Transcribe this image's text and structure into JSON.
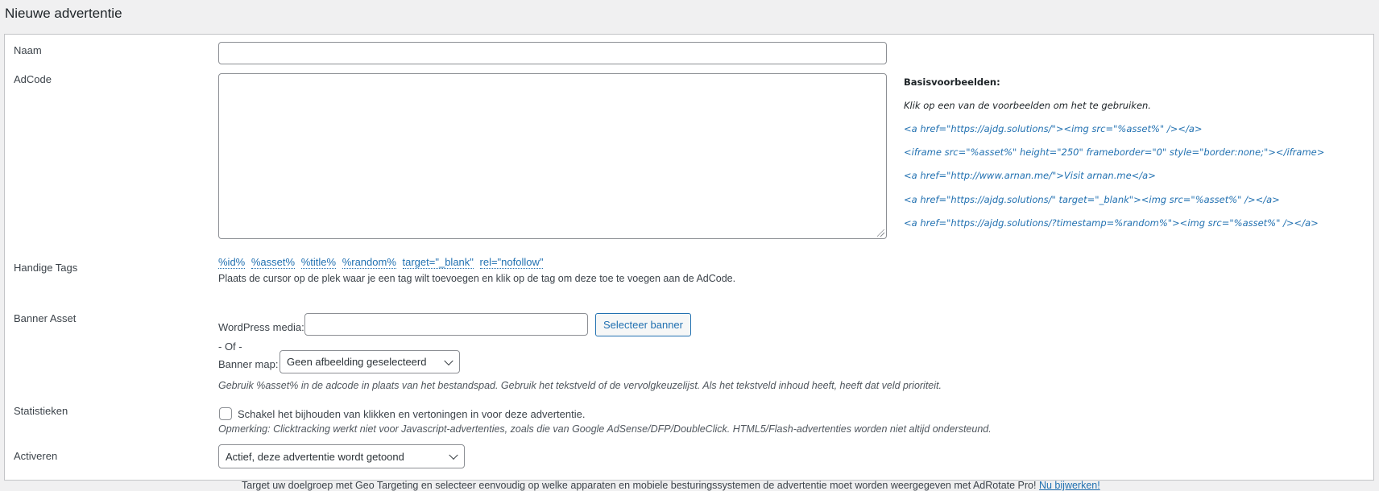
{
  "page": {
    "title": "Nieuwe advertentie"
  },
  "fields": {
    "name": {
      "label": "Naam",
      "value": "",
      "placeholder": ""
    },
    "adcode": {
      "label": "AdCode",
      "value": ""
    },
    "tags": {
      "label": "Handige Tags",
      "items": [
        "%id%",
        "%asset%",
        "%title%",
        "%random%",
        "target=\"_blank\"",
        "rel=\"nofollow\""
      ],
      "hint": "Plaats de cursor op de plek waar je een tag wilt toevoegen en klik op de tag om deze toe te voegen aan de AdCode."
    },
    "banner": {
      "label": "Banner Asset",
      "media_label": "WordPress media:",
      "media_value": "",
      "select_button": "Selecteer banner",
      "or_text": "- Of -",
      "folder_label": "Banner map:",
      "folder_selected": "Geen afbeelding geselecteerd",
      "note": "Gebruik %asset% in de adcode in plaats van het bestandspad. Gebruik het tekstveld of de vervolgkeuzelijst. Als het tekstveld inhoud heeft, heeft dat veld prioriteit."
    },
    "stats": {
      "label": "Statistieken",
      "checkbox_label": "Schakel het bijhouden van klikken en vertoningen in voor deze advertentie.",
      "checked": false,
      "note": "Opmerking: Clicktracking werkt niet voor Javascript-advertenties, zoals die van Google AdSense/DFP/DoubleClick. HTML5/Flash-advertenties worden niet altijd ondersteund."
    },
    "activate": {
      "label": "Activeren",
      "selected": "Actief, deze advertentie wordt getoond"
    }
  },
  "examples": {
    "title": "Basisvoorbeelden:",
    "hint": "Klik op een van de voorbeelden om het te gebruiken.",
    "items": [
      "<a href=\"https://ajdg.solutions/\"><img src=\"%asset%\" /></a>",
      "<iframe src=\"%asset%\" height=\"250\" frameborder=\"0\" style=\"border:none;\"></iframe>",
      "<a href=\"http://www.arnan.me/\">Visit arnan.me</a>",
      "<a href=\"https://ajdg.solutions/\" target=\"_blank\"><img src=\"%asset%\" /></a>",
      "<a href=\"https://ajdg.solutions/?timestamp=%random%\"><img src=\"%asset%\" /></a>"
    ]
  },
  "footer": {
    "text": "Target uw doelgroep met Geo Targeting en selecteer eenvoudig op welke apparaten en mobiele besturingssystemen de advertentie moet worden weergegeven met AdRotate Pro!",
    "link": "Nu bijwerken!"
  }
}
